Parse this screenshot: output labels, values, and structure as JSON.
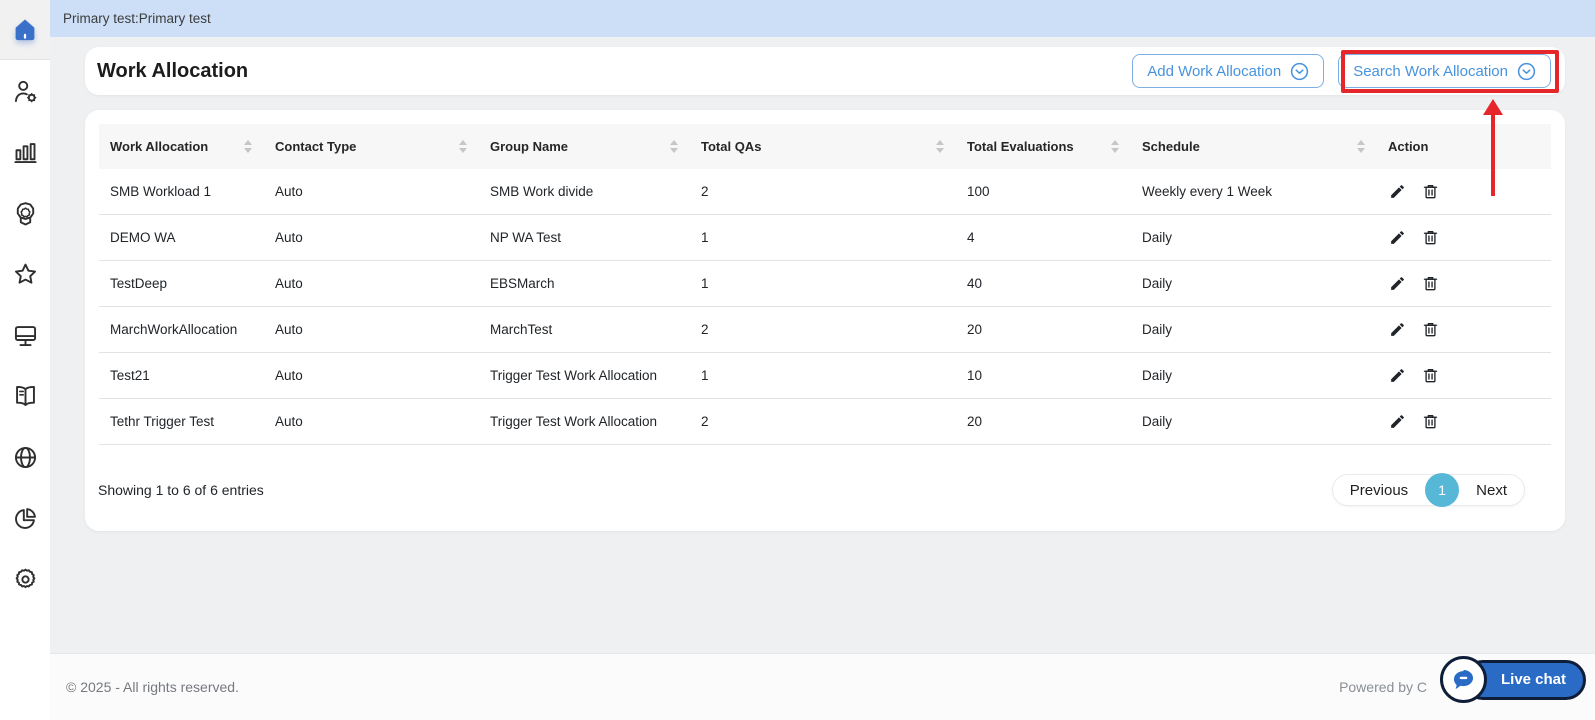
{
  "topbar": {
    "breadcrumb": "Primary test:Primary test"
  },
  "sidebar": {
    "items": [
      {
        "id": "home",
        "icon": "home-icon"
      },
      {
        "id": "user-management",
        "icon": "user-settings-icon"
      },
      {
        "id": "reports",
        "icon": "bar-chart-icon"
      },
      {
        "id": "quality",
        "icon": "quality-badge-icon"
      },
      {
        "id": "favorites",
        "icon": "star-icon"
      },
      {
        "id": "workstation",
        "icon": "monitor-icon"
      },
      {
        "id": "library",
        "icon": "book-icon"
      },
      {
        "id": "global",
        "icon": "globe-icon"
      },
      {
        "id": "analytics",
        "icon": "pie-chart-icon"
      },
      {
        "id": "settings",
        "icon": "gear-icon"
      }
    ]
  },
  "header": {
    "title": "Work Allocation",
    "add_button_label": "Add Work Allocation",
    "search_button_label": "Search Work Allocation"
  },
  "table": {
    "columns": [
      "Work Allocation",
      "Contact Type",
      "Group Name",
      "Total QAs",
      "Total Evaluations",
      "Schedule",
      "Action"
    ],
    "rows": [
      [
        "SMB Workload 1",
        "Auto",
        "SMB Work divide",
        "2",
        "100",
        "Weekly every 1 Week"
      ],
      [
        "DEMO WA",
        "Auto",
        "NP WA Test",
        "1",
        "4",
        "Daily"
      ],
      [
        "TestDeep",
        "Auto",
        "EBSMarch",
        "1",
        "40",
        "Daily"
      ],
      [
        "MarchWorkAllocation",
        "Auto",
        "MarchTest",
        "2",
        "20",
        "Daily"
      ],
      [
        "Test21",
        "Auto",
        "Trigger Test Work Allocation",
        "1",
        "10",
        "Daily"
      ],
      [
        "Tethr Trigger Test",
        "Auto",
        "Trigger Test Work Allocation",
        "2",
        "20",
        "Daily"
      ]
    ]
  },
  "pagination": {
    "summary": "Showing 1 to 6 of 6 entries",
    "previous_label": "Previous",
    "current_page": "1",
    "next_label": "Next"
  },
  "footer": {
    "copyright": "© 2025 - All rights reserved.",
    "powered_by": "Powered by C",
    "live_chat_label": "Live chat"
  },
  "colors": {
    "accent_blue": "#4793de",
    "topbar_blue": "#cddff7",
    "active_page_blue": "#56b7d6",
    "chat_blue": "#2a6cc5",
    "annotation_red": "#e5262b",
    "home_icon_blue": "#3b70c9"
  }
}
